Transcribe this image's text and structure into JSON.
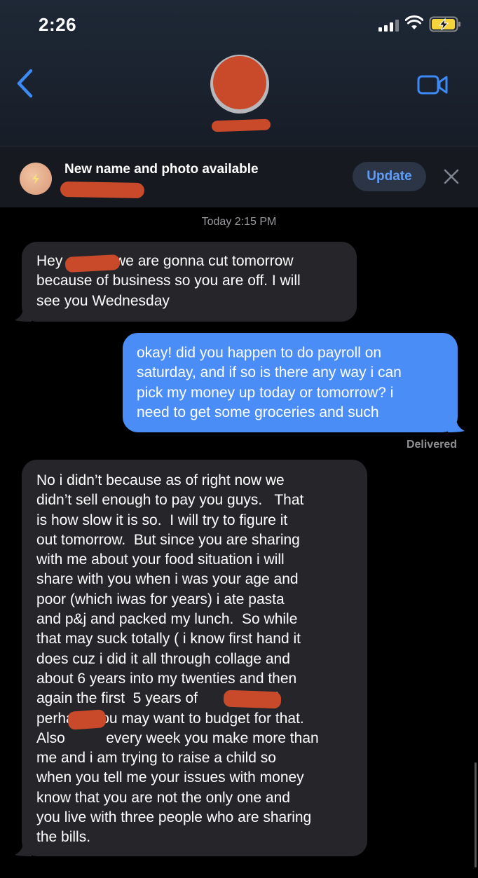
{
  "status_bar": {
    "time": "2:26"
  },
  "banner": {
    "title": "New name and photo available",
    "update_label": "Update"
  },
  "thread": {
    "timestamp": "Today 2:15 PM",
    "messages": [
      {
        "from": "them",
        "text": "Hey        so we are gonna cut tomorrow\nbecause of business so you are off. I will\nsee you Wednesday"
      },
      {
        "from": "me",
        "text": "okay! did you happen to do payroll on\nsaturday, and if so is there any way i can\npick my money up today or tomorrow? i\nneed to get some groceries and such"
      },
      {
        "from": "them",
        "text": "No i didn’t because as of right now we\ndidn’t sell enough to pay you guys.   That\nis how slow it is so.  I will try to figure it\nout tomorrow.  But since you are sharing\nwith me about your food situation i will\nshare with you when i was your age and\npoor (which iwas for years) i ate pasta\nand p&j and packed my lunch.  So while\nthat may suck totally ( i know first hand it\ndoes cuz i did it all through collage and\nabout 6 years into my twenties and then\nagain the first  5 years of           ’s life)\nperhaps you may want to budget for that.\nAlso          every week you make more than\nme and i am trying to raise a child so\nwhen you tell me your issues with money\nknow that you are not the only one and\nyou live with three people who are sharing\nthe bills."
      }
    ],
    "delivered": "Delivered"
  },
  "colors": {
    "sent": "#4b8df7",
    "received": "#26262a",
    "redaction": "#c94a2a",
    "accent": "#5f9cf5"
  }
}
